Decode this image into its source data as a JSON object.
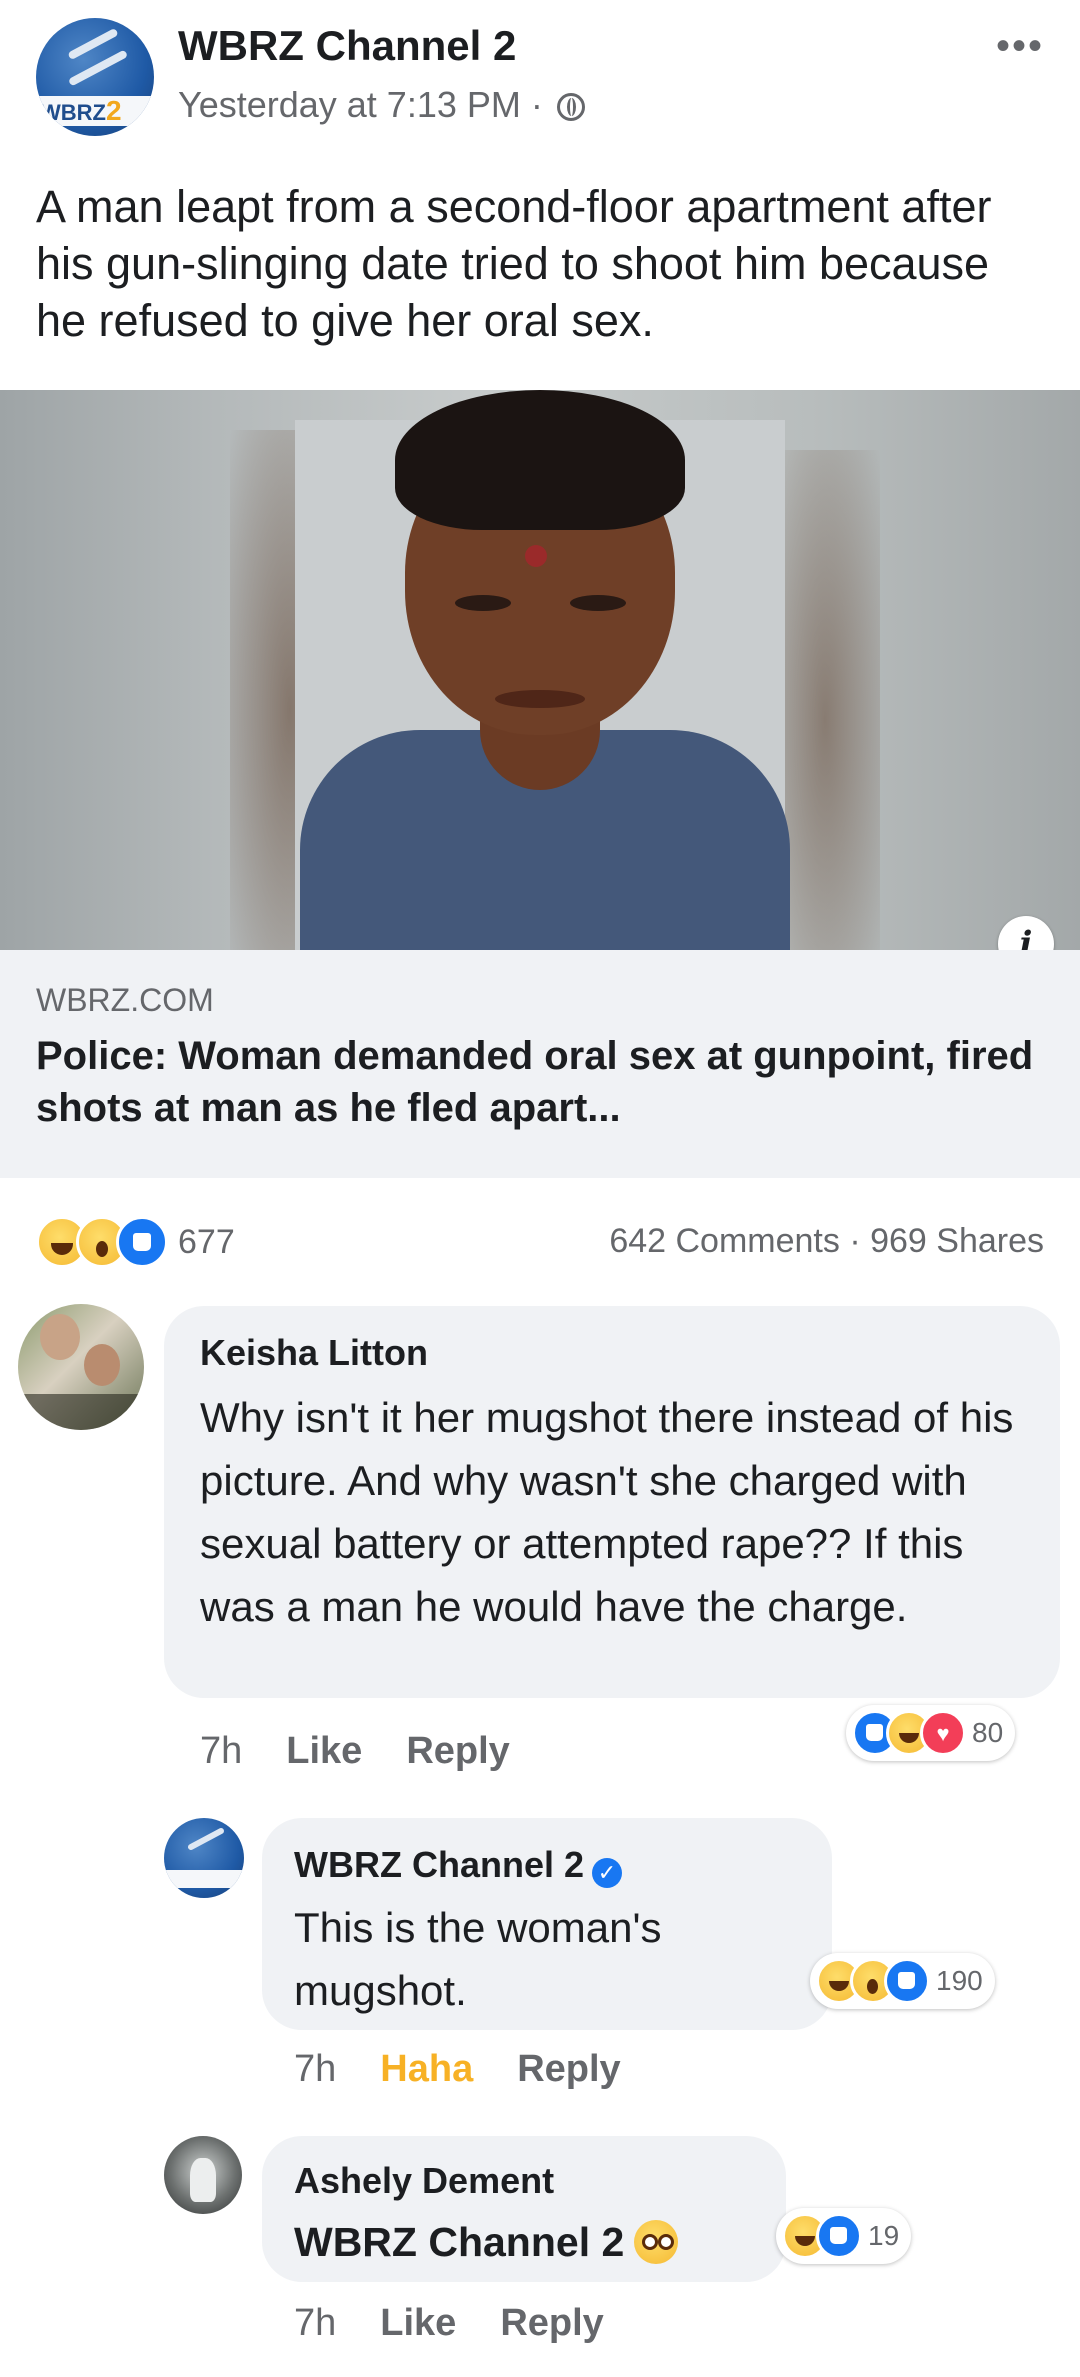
{
  "post": {
    "page_name": "WBRZ Channel 2",
    "time": "Yesterday at 7:13 PM ·",
    "avatar_brand": "WBRZ",
    "avatar_number": "2",
    "text": "A man leapt from a second-floor apartment after his gun-slinging date tried to shoot him because he refused to give her oral sex."
  },
  "link": {
    "domain": "WBRZ.COM",
    "title": "Police: Woman demanded oral sex at gunpoint, fired shots at man as he fled apart...",
    "info_glyph": "i"
  },
  "stats": {
    "reactions": [
      "haha",
      "wow",
      "like"
    ],
    "reaction_count": "677",
    "comments_shares": "642 Comments · 969 Shares"
  },
  "comments": [
    {
      "author": "Keisha Litton",
      "text": "Why isn't it her mugshot there instead of his picture. And why wasn't she charged with sexual battery or attempted rape?? If this was a man he would have the charge.",
      "time": "7h",
      "like": "Like",
      "reply": "Reply",
      "reactions": [
        "like",
        "haha",
        "love"
      ],
      "reaction_count": "80"
    },
    {
      "author": "WBRZ Channel 2",
      "text": "This is the woman's mugshot.",
      "time": "7h",
      "like": "Haha",
      "reply": "Reply",
      "reactions": [
        "haha",
        "wow",
        "like"
      ],
      "reaction_count": "190"
    },
    {
      "author": "Ashely Dement",
      "text": "WBRZ Channel 2",
      "time": "7h",
      "like": "Like",
      "reply": "Reply",
      "reactions": [
        "haha",
        "like"
      ],
      "reaction_count": "19"
    }
  ]
}
